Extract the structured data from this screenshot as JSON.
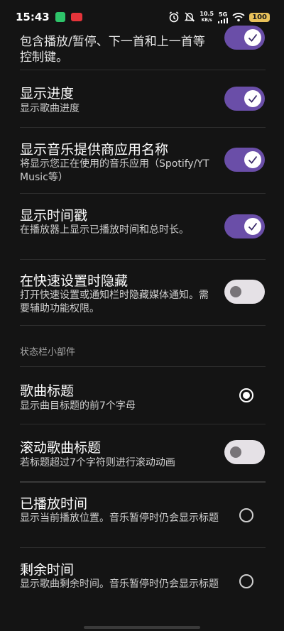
{
  "status_bar": {
    "time": "15:43",
    "network_speed_value": "10.5",
    "network_speed_unit": "KB/s",
    "network_type": "5G",
    "battery": "100"
  },
  "settings_top": [
    {
      "id": "media-controls",
      "title": "",
      "summary": "包含播放/暂停、下一首和上一首等控制键。",
      "state": "on"
    },
    {
      "id": "show-progress",
      "title": "显示进度",
      "summary": "显示歌曲进度",
      "state": "on"
    },
    {
      "id": "show-provider",
      "title": "显示音乐提供商应用名称",
      "summary": "将显示您正在使用的音乐应用（Spotify/YT Music等）",
      "state": "on"
    },
    {
      "id": "show-timestamp",
      "title": "显示时间戳",
      "summary": "在播放器上显示已播放时间和总时长。",
      "state": "on"
    },
    {
      "id": "hide-in-qs",
      "title": "在快速设置时隐藏",
      "summary": "打开快速设置或通知栏时隐藏媒体通知。需要辅助功能权限。",
      "state": "off"
    }
  ],
  "section_header": "状态栏小部件",
  "settings_bottom": [
    {
      "id": "song-title",
      "title": "歌曲标题",
      "summary": "显示曲目标题的前7个字母",
      "control": "radio",
      "state": "checked"
    },
    {
      "id": "scroll-title",
      "title": "滚动歌曲标题",
      "summary": "若标题超过7个字符则进行滚动动画",
      "control": "switch",
      "state": "off"
    },
    {
      "id": "elapsed-time",
      "title": "已播放时间",
      "summary": "显示当前播放位置。音乐暂停时仍会显示标题",
      "control": "radio",
      "state": "unchecked"
    },
    {
      "id": "remaining-time",
      "title": "剩余时间",
      "summary": "显示歌曲剩余时间。音乐暂停时仍会显示标题",
      "control": "radio",
      "state": "unchecked"
    }
  ],
  "colors": {
    "background": "#141414",
    "switch_on": "#6a4ea8",
    "switch_off": "#e5e1e6",
    "battery": "#e8c15a"
  }
}
